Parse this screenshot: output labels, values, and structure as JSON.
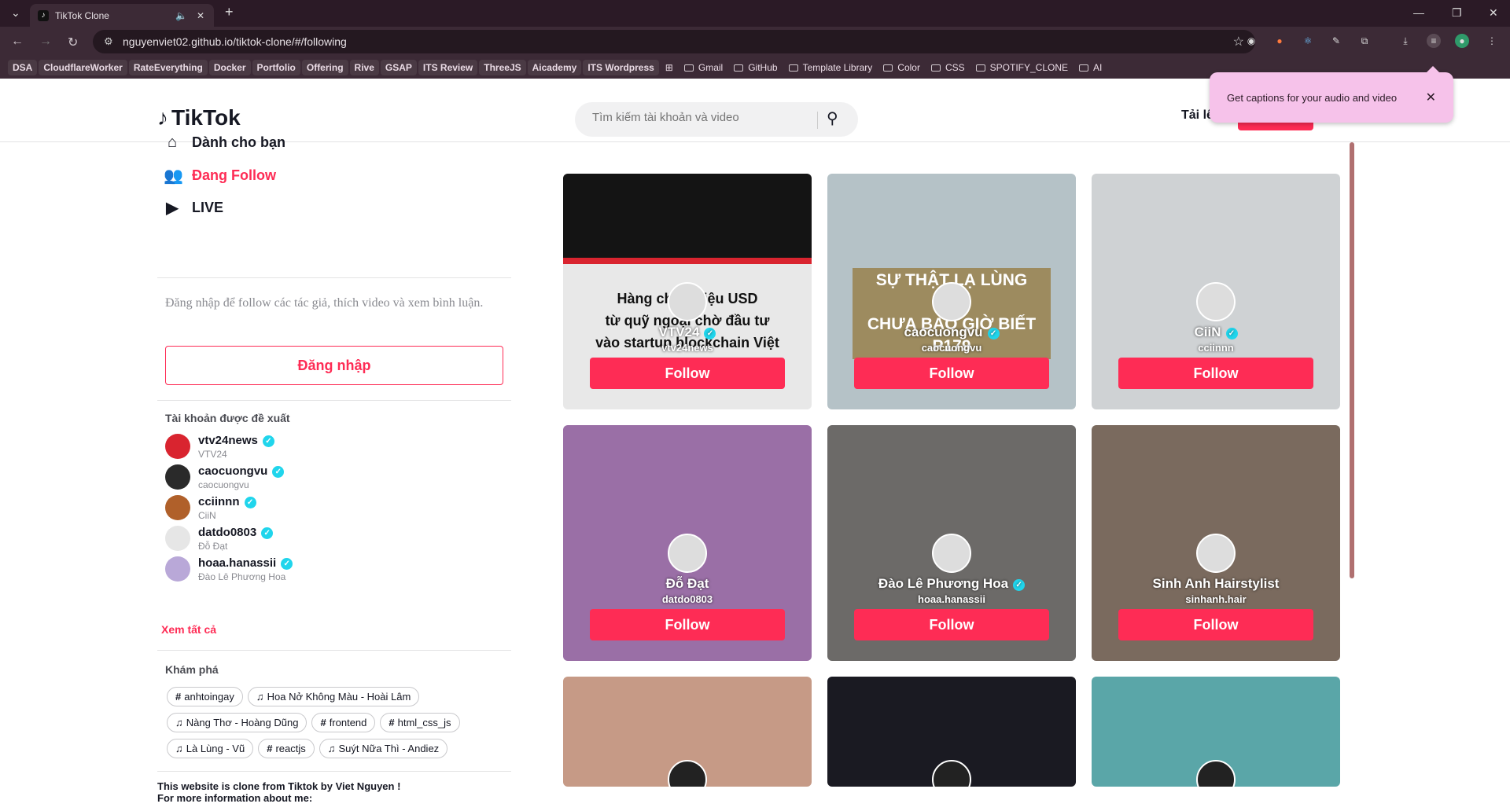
{
  "browser": {
    "tab_title": "TikTok Clone",
    "url": "nguyenviet02.github.io/tiktok-clone/#/following",
    "bookmarks": [
      {
        "label": "DSA",
        "chip": true
      },
      {
        "label": "CloudflareWorker",
        "chip": true
      },
      {
        "label": "RateEverything",
        "chip": true
      },
      {
        "label": "Docker",
        "chip": true
      },
      {
        "label": "Portfolio",
        "chip": true
      },
      {
        "label": "Offering",
        "chip": true
      },
      {
        "label": "Rive",
        "chip": true
      },
      {
        "label": "GSAP",
        "chip": true
      },
      {
        "label": "ITS Review",
        "chip": true
      },
      {
        "label": "ThreeJS",
        "chip": true
      },
      {
        "label": "Aicademy",
        "chip": true
      },
      {
        "label": "ITS Wordpress",
        "chip": true
      },
      {
        "label": "Gmail",
        "chip": false
      },
      {
        "label": "GitHub",
        "chip": false
      },
      {
        "label": "Template Library",
        "chip": false
      },
      {
        "label": "Color",
        "chip": false
      },
      {
        "label": "CSS",
        "chip": false
      },
      {
        "label": "SPOTIFY_CLONE",
        "chip": false
      },
      {
        "label": "AI",
        "chip": false
      }
    ],
    "caption_tooltip": "Get captions for your audio and video"
  },
  "header": {
    "logo": "TikTok",
    "search_placeholder": "Tìm kiếm tài khoản và video",
    "upload": "Tải lê"
  },
  "sidebar": {
    "menu": [
      {
        "label": "Dành cho bạn",
        "icon": "home-icon",
        "active": false
      },
      {
        "label": "Đang Follow",
        "icon": "users-icon",
        "active": true
      },
      {
        "label": "LIVE",
        "icon": "video-camera-icon",
        "active": false
      }
    ],
    "login_hint": "Đăng nhập để follow các tác giả, thích video và xem bình luận.",
    "login_button": "Đăng nhập",
    "suggested_title": "Tài khoản được đề xuất",
    "accounts": [
      {
        "username": "vtv24news",
        "name": "VTV24",
        "color": "#d9242f"
      },
      {
        "username": "caocuongvu",
        "name": "caocuongvu",
        "color": "#2a2a2a"
      },
      {
        "username": "cciinnn",
        "name": "CiiN",
        "color": "#b0602a"
      },
      {
        "username": "datdo0803",
        "name": "Đỗ Đạt",
        "color": "#e6e6e6"
      },
      {
        "username": "hoaa.hanassii",
        "name": "Đào Lê Phương Hoa",
        "color": "#b9a8d8"
      }
    ],
    "see_all": "Xem tất cả",
    "discover_title": "Khám phá",
    "tags": [
      {
        "icon": "#",
        "label": "anhtoingay"
      },
      {
        "icon": "♫",
        "label": "Hoa Nở Không Màu - Hoài Lâm"
      },
      {
        "icon": "♫",
        "label": "Nàng Thơ - Hoàng Dũng"
      },
      {
        "icon": "#",
        "label": "frontend"
      },
      {
        "icon": "#",
        "label": "html_css_js"
      },
      {
        "icon": "♫",
        "label": "Là Lùng - Vũ"
      },
      {
        "icon": "#",
        "label": "reactjs"
      },
      {
        "icon": "♫",
        "label": "Suýt Nữa Thì - Andiez"
      }
    ],
    "footer_line1": "This website is clone from Tiktok by Viet Nguyen !",
    "footer_line2": "For more information about me:"
  },
  "cards": [
    {
      "name": "VTV24",
      "username": "vtv24news",
      "verified": true,
      "follow": "Follow",
      "bg": "#e8e8e8",
      "overlay": "Hàng chục triệu USD\ntừ quỹ ngoại chờ đầu tư\nvào startup blockchain Việt"
    },
    {
      "name": "caocuongvu",
      "username": "caocuongvu",
      "verified": true,
      "follow": "Follow",
      "bg": "#b5c2c7",
      "overlay": "SỰ THẬT LẠ LÙNG BẠN\nCHƯA BAO GIỜ BIẾT\nP179"
    },
    {
      "name": "CiiN",
      "username": "cciinnn",
      "verified": true,
      "follow": "Follow",
      "bg": "#cfd2d4",
      "overlay": ""
    },
    {
      "name": "Đỗ Đạt",
      "username": "datdo0803",
      "verified": false,
      "follow": "Follow",
      "bg": "#9a6fa6",
      "overlay": ""
    },
    {
      "name": "Đào Lê Phương Hoa",
      "username": "hoaa.hanassii",
      "verified": true,
      "follow": "Follow",
      "bg": "#6c6a68",
      "overlay": ""
    },
    {
      "name": "Sinh Anh Hairstylist",
      "username": "sinhanh.hair",
      "verified": false,
      "follow": "Follow",
      "bg": "#7a6a5e",
      "overlay": ""
    },
    {
      "name": "",
      "username": "",
      "verified": false,
      "follow": "",
      "bg": "#c69a86",
      "overlay": ""
    },
    {
      "name": "",
      "username": "",
      "verified": false,
      "follow": "",
      "bg": "#1a1a22",
      "overlay": ""
    },
    {
      "name": "",
      "username": "",
      "verified": false,
      "follow": "",
      "bg": "#5aa6a8",
      "overlay": ""
    }
  ]
}
